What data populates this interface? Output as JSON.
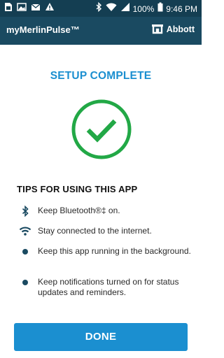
{
  "status_bar": {
    "battery_percent": "100%",
    "time": "9:46 PM",
    "left_icons": [
      "sim-icon",
      "image-icon",
      "mail-icon",
      "alert-icon"
    ],
    "right_icons": [
      "bluetooth-icon",
      "wifi-icon",
      "signal-icon",
      "battery-icon"
    ]
  },
  "app_bar": {
    "title": "myMerlinPulse™",
    "brand": "Abbott"
  },
  "main": {
    "headline": "SETUP COMPLETE",
    "tips_title": "TIPS FOR USING THIS APP",
    "tips": [
      {
        "icon": "bluetooth-icon",
        "text": "Keep Bluetooth®‡ on."
      },
      {
        "icon": "wifi-icon",
        "text": "Stay connected to the internet."
      },
      {
        "icon": "bullet-icon",
        "text": "Keep this app running in the background."
      },
      {
        "icon": "bullet-icon",
        "text": "Keep notifications turned on for status updates and reminders."
      }
    ]
  },
  "done_label": "DONE",
  "colors": {
    "status_bar": "#143e52",
    "app_bar": "#1a4a61",
    "accent_blue": "#1b8fd0",
    "check_green": "#22a846"
  }
}
